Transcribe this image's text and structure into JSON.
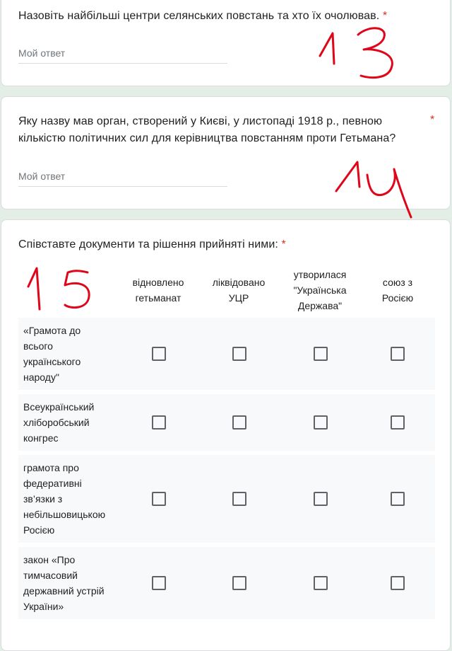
{
  "questions": [
    {
      "title": "Назовіть найбільші центри селянських повстань та хто їх очолював.",
      "required_mark": "*",
      "placeholder": "Мой ответ",
      "annotation": "13"
    },
    {
      "title_line1": "Яку назву мав орган, створений у Києві, у листопаді 1918 р.,  певною",
      "title_line2": "кількістю політичних сил для керівництва повстанням проти Гетьмана?",
      "required_mark": "*",
      "placeholder": "Мой ответ",
      "annotation": "14"
    },
    {
      "title": "Співставте документи та рішення прийняті ними:",
      "required_mark": "*",
      "annotation": "15",
      "columns": [
        {
          "line1": "відновлено",
          "line2": "гетьманат"
        },
        {
          "line1": "ліквідовано",
          "line2": "УЦР"
        },
        {
          "line1": "утворилася",
          "line2": "\"Українська",
          "line3": "Держава\""
        },
        {
          "line1": "союз з",
          "line2": "Росією"
        }
      ],
      "rows": [
        {
          "lines": [
            "«Грамота до",
            "всього",
            "українського",
            "народу\""
          ],
          "checked": [
            false,
            false,
            false,
            false
          ]
        },
        {
          "lines": [
            "Всеукраїнський",
            "хліборобський",
            "конгрес"
          ],
          "checked": [
            false,
            false,
            false,
            false
          ]
        },
        {
          "lines": [
            "грамота про",
            "федеративні",
            "зв’язки з",
            "небільшовицькою",
            "Росією"
          ],
          "checked": [
            false,
            false,
            false,
            false
          ]
        },
        {
          "lines": [
            "закон «Про",
            "тимчасовий",
            "державний устрій",
            "України»"
          ],
          "checked": [
            false,
            false,
            false,
            false
          ]
        }
      ]
    }
  ],
  "colors": {
    "background": "#e3efe6",
    "required": "#d93025",
    "annotation_ink": "#e0061a"
  }
}
